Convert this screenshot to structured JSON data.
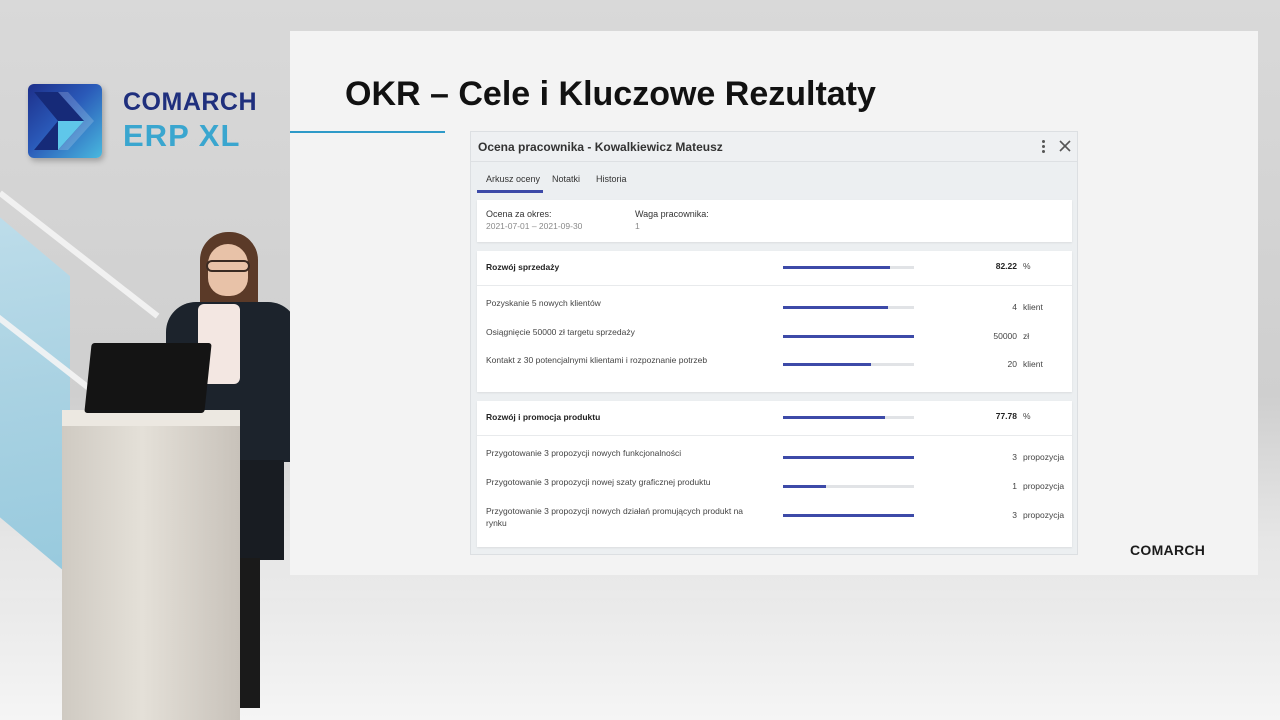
{
  "logo": {
    "line1": "COMARCH",
    "line2": "ERP XL"
  },
  "slide": {
    "title": "OKR – Cele i Kluczowe Rezultaty",
    "footer_brand": "COMARCH"
  },
  "window": {
    "title": "Ocena pracownika - Kowalkiewicz Mateusz",
    "tabs": [
      {
        "label": "Arkusz oceny",
        "active": true
      },
      {
        "label": "Notatki",
        "active": false
      },
      {
        "label": "Historia",
        "active": false
      }
    ],
    "info": {
      "period_label": "Ocena za okres:",
      "period_value": "2021-07-01 – 2021-09-30",
      "weight_label": "Waga pracownika:",
      "weight_value": "1"
    },
    "objectives": [
      {
        "name": "Rozwój sprzedaży",
        "progress": 0.82,
        "value": "82.22",
        "unit": "%",
        "key_results": [
          {
            "name": "Pozyskanie 5 nowych klientów",
            "progress": 0.8,
            "value": "4",
            "unit": "klient"
          },
          {
            "name": "Osiągnięcie 50000 zł targetu sprzedaży",
            "progress": 1.0,
            "value": "50000",
            "unit": "zł"
          },
          {
            "name": "Kontakt z 30 potencjalnymi klientami i rozpoznanie potrzeb",
            "progress": 0.67,
            "value": "20",
            "unit": "klient"
          }
        ]
      },
      {
        "name": "Rozwój i promocja produktu",
        "progress": 0.78,
        "value": "77.78",
        "unit": "%",
        "key_results": [
          {
            "name": "Przygotowanie 3 propozycji nowych funkcjonalności",
            "progress": 1.0,
            "value": "3",
            "unit": "propozycja"
          },
          {
            "name": "Przygotowanie 3 propozycji nowej szaty graficznej produktu",
            "progress": 0.33,
            "value": "1",
            "unit": "propozycja"
          },
          {
            "name": "Przygotowanie 3 propozycji nowych działań promujących produkt na rynku",
            "progress": 1.0,
            "value": "3",
            "unit": "propozycja"
          }
        ]
      }
    ],
    "icons": {
      "menu": "more-vertical-icon",
      "close": "close-icon"
    },
    "colors": {
      "accent": "#3d4aa8",
      "track": "#e1e3e6"
    }
  }
}
